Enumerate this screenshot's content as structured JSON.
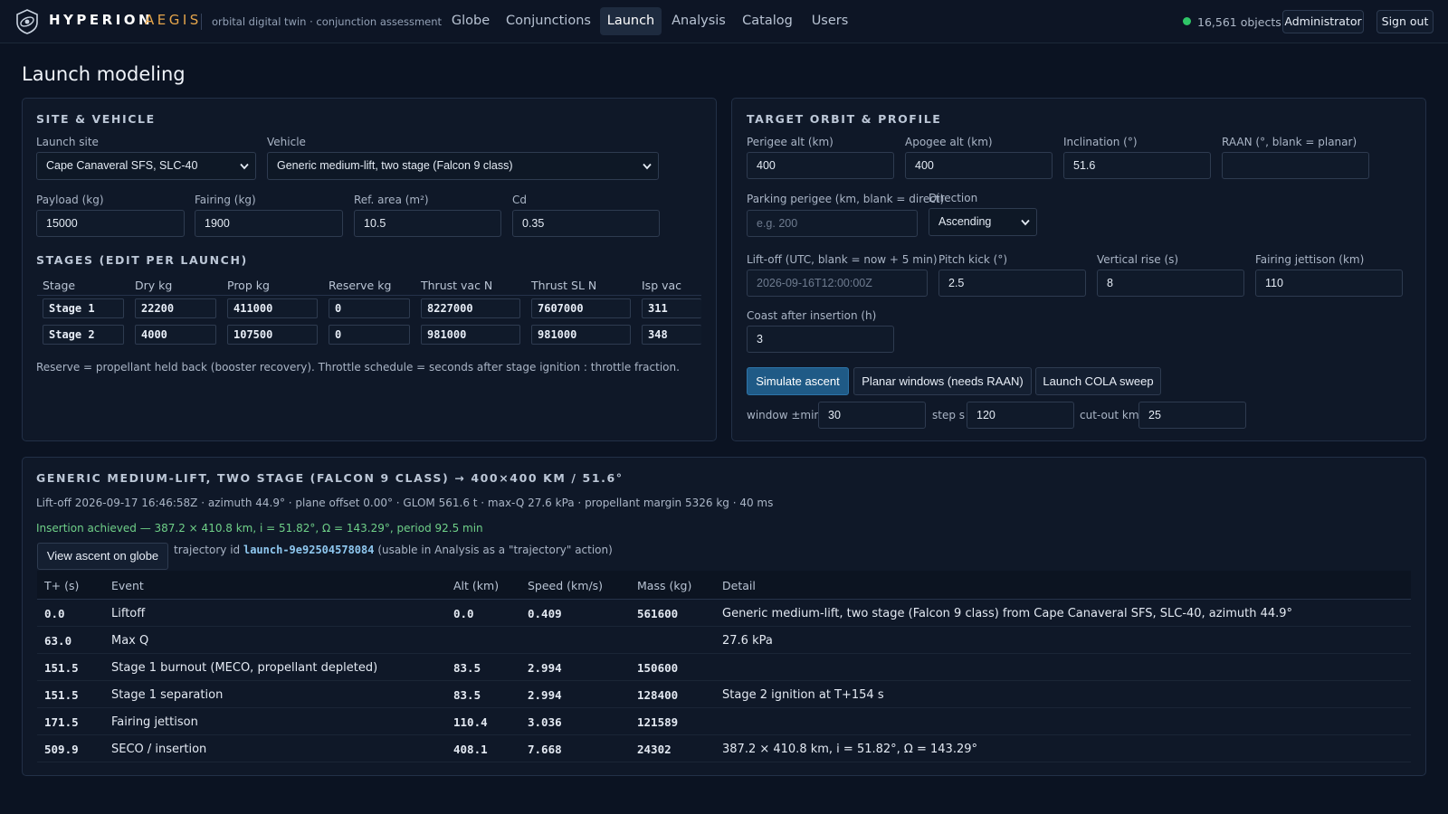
{
  "brand": {
    "name": "HYPERION",
    "accent": "AEGIS",
    "tagline": "orbital digital twin · conjunction assessment"
  },
  "nav": [
    "Globe",
    "Conjunctions",
    "Launch",
    "Analysis",
    "Catalog",
    "Users"
  ],
  "nav_active": "Launch",
  "status": {
    "objects": "16,561 objects",
    "color": "#2fc567"
  },
  "user": {
    "role": "Administrator",
    "signout": "Sign out"
  },
  "page_title": "Launch modeling",
  "site_vehicle": {
    "title": "SITE & VEHICLE",
    "launch_site_label": "Launch site",
    "launch_site": "Cape Canaveral SFS, SLC-40",
    "vehicle_label": "Vehicle",
    "vehicle": "Generic medium-lift, two stage (Falcon 9 class)",
    "payload_label": "Payload (kg)",
    "payload": "15000",
    "fairing_label": "Fairing (kg)",
    "fairing": "1900",
    "area_label": "Ref. area (m²)",
    "area": "10.5",
    "cd_label": "Cd",
    "cd": "0.35"
  },
  "stages": {
    "title": "STAGES (EDIT PER LAUNCH)",
    "columns": [
      "Stage",
      "Dry kg",
      "Prop kg",
      "Reserve kg",
      "Thrust vac N",
      "Thrust SL N",
      "Isp vac"
    ],
    "rows": [
      [
        "Stage 1",
        "22200",
        "411000",
        "0",
        "8227000",
        "7607000",
        "311"
      ],
      [
        "Stage 2",
        "4000",
        "107500",
        "0",
        "981000",
        "981000",
        "348"
      ]
    ],
    "note": "Reserve = propellant held back (booster recovery). Throttle schedule = seconds after stage ignition : throttle fraction."
  },
  "target": {
    "title": "TARGET ORBIT & PROFILE",
    "perigee_label": "Perigee alt (km)",
    "perigee": "400",
    "apogee_label": "Apogee alt (km)",
    "apogee": "400",
    "incl_label": "Inclination (°)",
    "incl": "51.6",
    "raan_label": "RAAN (°, blank = planar)",
    "raan": "",
    "parking_label": "Parking perigee (km, blank = direct)",
    "parking_placeholder": "e.g. 200",
    "direction_label": "Direction",
    "direction": "Ascending",
    "liftoff_label": "Lift-off (UTC, blank = now + 5 min)",
    "liftoff_placeholder": "2026-09-16T12:00:00Z",
    "pitch_label": "Pitch kick (°)",
    "pitch": "2.5",
    "vrise_label": "Vertical rise (s)",
    "vrise": "8",
    "fjet_label": "Fairing jettison (km)",
    "fjet": "110",
    "coast_label": "Coast after insertion (h)",
    "coast": "3",
    "btn_simulate": "Simulate ascent",
    "btn_planar": "Planar windows (needs RAAN)",
    "btn_cola": "Launch COLA sweep",
    "window_label": "window ±min",
    "window": "30",
    "step_label": "step s",
    "step": "120",
    "cutout_label": "cut-out km",
    "cutout": "25"
  },
  "result": {
    "title": "GENERIC MEDIUM-LIFT, TWO STAGE (FALCON 9 CLASS) → 400×400 KM / 51.6°",
    "summary": "Lift-off 2026-09-17 16:46:58Z · azimuth 44.9° · plane offset 0.00° · GLOM 561.6 t · max-Q 27.6 kPa · propellant margin 5326 kg · 40 ms",
    "insertion": "Insertion achieved — 387.2 × 410.8 km, i = 51.82°, Ω = 143.29°, period 92.5 min",
    "view_button": "View ascent on globe",
    "traj_prefix": "trajectory id",
    "traj_id": "launch-9e92504578084",
    "traj_suffix": "(usable in Analysis as a \"trajectory\" action)",
    "columns": [
      "T+ (s)",
      "Event",
      "Alt (km)",
      "Speed (km/s)",
      "Mass (kg)",
      "Detail"
    ],
    "events": [
      [
        "0.0",
        "Liftoff",
        "0.0",
        "0.409",
        "561600",
        "Generic medium-lift, two stage (Falcon 9 class) from Cape Canaveral SFS, SLC-40, azimuth 44.9°"
      ],
      [
        "63.0",
        "Max Q",
        "",
        "",
        "",
        "27.6 kPa"
      ],
      [
        "151.5",
        "Stage 1 burnout (MECO, propellant depleted)",
        "83.5",
        "2.994",
        "150600",
        ""
      ],
      [
        "151.5",
        "Stage 1 separation",
        "83.5",
        "2.994",
        "128400",
        "Stage 2 ignition at T+154 s"
      ],
      [
        "171.5",
        "Fairing jettison",
        "110.4",
        "3.036",
        "121589",
        ""
      ],
      [
        "509.9",
        "SECO / insertion",
        "408.1",
        "7.668",
        "24302",
        "387.2 × 410.8 km, i = 51.82°, Ω = 143.29°"
      ]
    ]
  },
  "icons": {
    "logo": "satellite-eye-icon",
    "select": "chevron-down-icon"
  }
}
